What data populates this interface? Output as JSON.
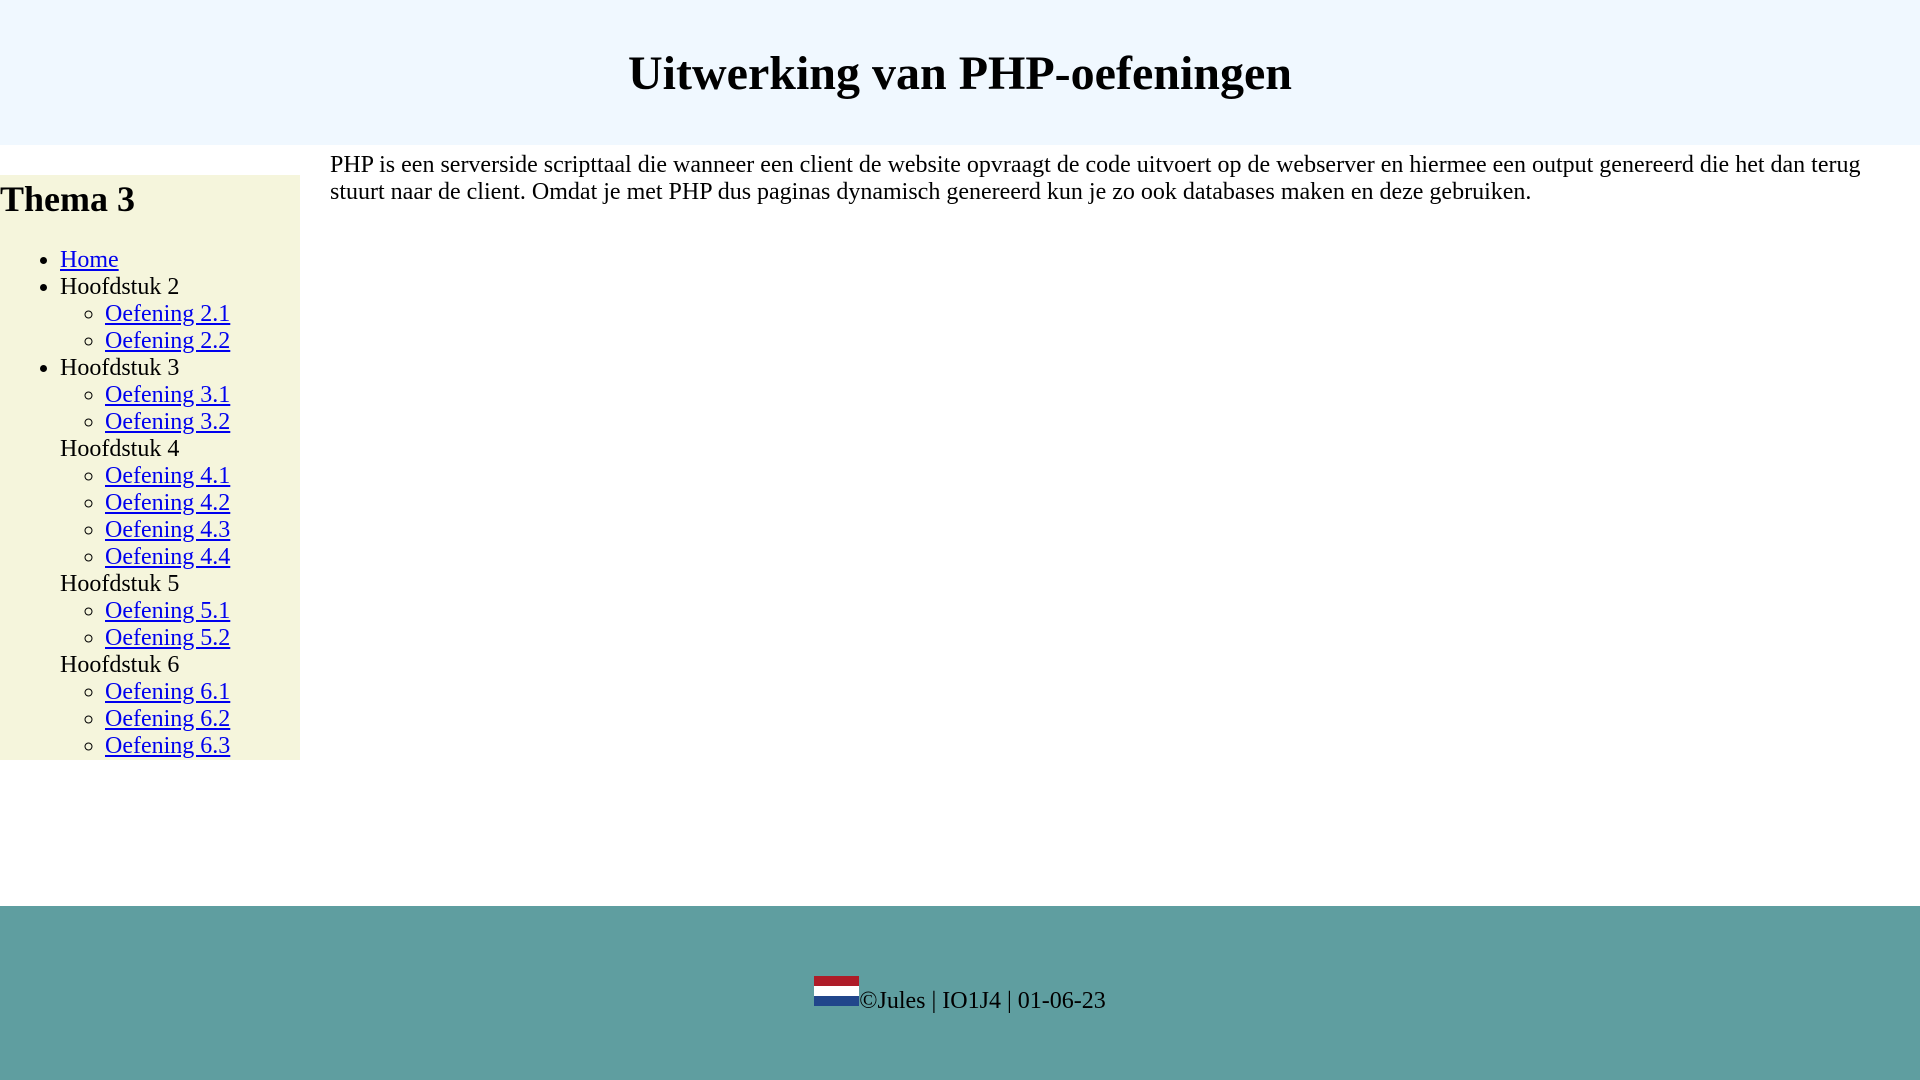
{
  "header": {
    "title": "Uitwerking van PHP-oefeningen"
  },
  "sidebar": {
    "title": "Thema 3",
    "home": "Home",
    "chapters": [
      {
        "label": "Hoofdstuk 2",
        "exercises": [
          "Oefening 2.1",
          "Oefening 2.2"
        ]
      },
      {
        "label": "Hoofdstuk 3",
        "exercises": [
          "Oefening 3.1",
          "Oefening 3.2"
        ]
      },
      {
        "label": "Hoofdstuk 4",
        "exercises": [
          "Oefening 4.1",
          "Oefening 4.2",
          "Oefening 4.3",
          "Oefening 4.4"
        ]
      },
      {
        "label": "Hoofdstuk 5",
        "exercises": [
          "Oefening 5.1",
          "Oefening 5.2"
        ]
      },
      {
        "label": "Hoofdstuk 6",
        "exercises": [
          "Oefening 6.1",
          "Oefening 6.2",
          "Oefening 6.3"
        ]
      }
    ]
  },
  "main": {
    "text": "PHP is een serverside scripttaal die wanneer een client de website opvraagt de code uitvoert op de webserver en hiermee een output genereerd die het dan terug stuurt naar de client. Omdat je met PHP dus paginas dynamisch genereerd kun je zo ook databases maken en deze gebruiken."
  },
  "footer": {
    "text": "©Jules | IO1J4 | 01-06-23",
    "flag_icon": "netherlands-flag-icon"
  },
  "colors": {
    "header_bg": "#f0f8ff",
    "sidebar_bg": "#f5f5dc",
    "footer_bg": "#5f9ea0",
    "link": "#0000ee",
    "flag_red": "#ae1c28",
    "flag_white": "#ffffff",
    "flag_blue": "#21468b"
  }
}
